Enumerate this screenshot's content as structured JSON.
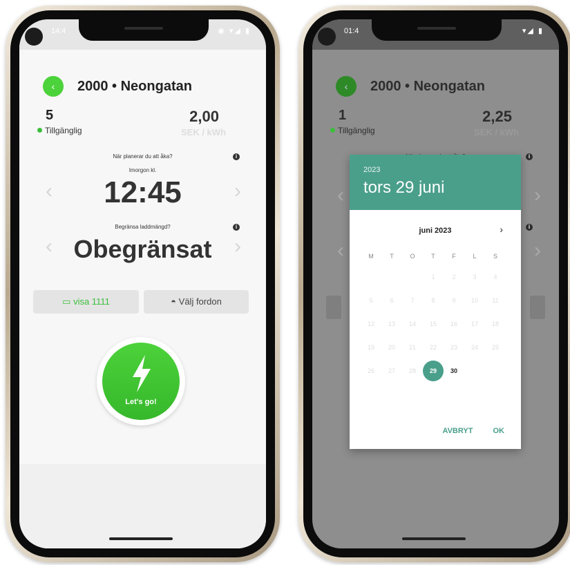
{
  "left_phone": {
    "status_time": "14:4",
    "status_icons": "◉ ▾◢ ▮",
    "station_title": "2000 • Neongatan",
    "back_icon": "chevron-left-icon",
    "available_count": "5",
    "available_label": "Tillgänglig",
    "price": "2,00",
    "price_unit": "SEK / kWh",
    "departure_question": "När planerar du att åka?",
    "departure_day": "Imorgon kl.",
    "departure_time": "12:45",
    "limit_question": "Begränsa laddmängd?",
    "limit_value": "Obegränsat",
    "card_button": "visa 1111",
    "vehicle_button": "Välj fordon",
    "go_button": "Let's go!",
    "colors": {
      "accent": "#4cd23a",
      "available_dot": "#3bbf3b"
    }
  },
  "right_phone": {
    "status_time": "01:4",
    "status_icons": "▾◢ ▮",
    "station_title": "2000 • Neongatan",
    "available_count": "1",
    "available_label": "Tillgänglig",
    "price": "2,25",
    "price_unit": "SEK / kWh",
    "departure_question": "När planerar du att åka?",
    "date_dialog": {
      "year": "2023",
      "selected_date": "tors 29 juni",
      "month_label": "juni 2023",
      "weekdays": [
        "M",
        "T",
        "O",
        "T",
        "F",
        "L",
        "S"
      ],
      "weeks": [
        [
          "",
          "",
          "",
          "1",
          "2",
          "3",
          "4"
        ],
        [
          "5",
          "6",
          "7",
          "8",
          "9",
          "10",
          "11"
        ],
        [
          "12",
          "13",
          "14",
          "15",
          "16",
          "17",
          "18"
        ],
        [
          "19",
          "20",
          "21",
          "22",
          "23",
          "24",
          "25"
        ],
        [
          "26",
          "27",
          "28",
          "29",
          "30",
          "",
          ""
        ]
      ],
      "selected_day": "29",
      "cancel_label": "AVBRYT",
      "ok_label": "OK",
      "accent_color": "#4a9f8b"
    }
  }
}
